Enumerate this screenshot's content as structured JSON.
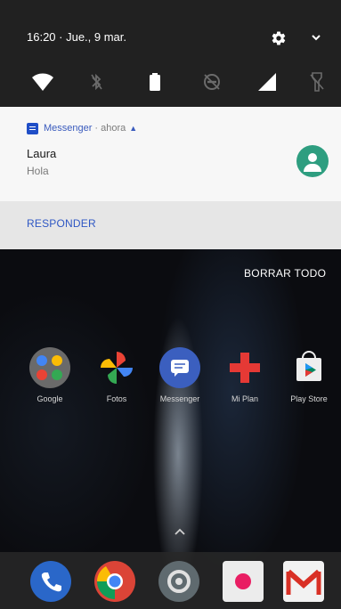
{
  "status": {
    "time_date": "16:20 · Jue., 9 mar."
  },
  "quick_settings": [
    "wifi-icon",
    "bluetooth-off-icon",
    "battery-icon",
    "dnd-off-icon",
    "signal-icon",
    "flashlight-off-icon"
  ],
  "notification": {
    "app_name": "Messenger",
    "separator": "·",
    "time": "ahora",
    "caret": "▲",
    "sender": "Laura",
    "message": "Hola",
    "reply_label": "RESPONDER"
  },
  "clear_all_label": "BORRAR TODO",
  "home_apps": [
    {
      "icon": "google-folder-icon",
      "label": "Google"
    },
    {
      "icon": "photos-icon",
      "label": "Fotos"
    },
    {
      "icon": "messenger-icon",
      "label": "Messenger"
    },
    {
      "icon": "first-aid-icon",
      "label": "Mi Plan"
    },
    {
      "icon": "play-store-icon",
      "label": "Play Store"
    }
  ],
  "dock_apps": [
    "phone-icon",
    "chrome-icon",
    "camera-icon",
    "media-icon",
    "gmail-icon"
  ],
  "colors": {
    "accent": "#2f57c4",
    "avatar": "#2e9e80",
    "shade": "#212121"
  }
}
